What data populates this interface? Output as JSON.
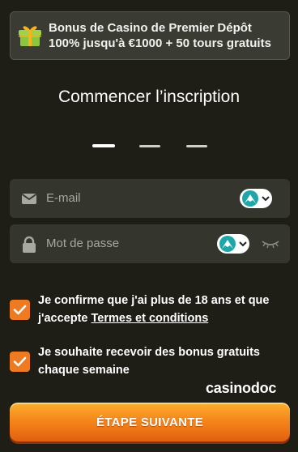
{
  "bonus": {
    "line1": "Bonus de Casino de Premier Dépôt",
    "line2": "100% jusqu'à €1000 + 50 tours gratuits"
  },
  "title": "Commencer l’inscription",
  "steps": {
    "total": 3,
    "current": 1
  },
  "form": {
    "email_placeholder": "E-mail",
    "password_placeholder": "Mot de passe"
  },
  "checkboxes": {
    "age": {
      "text": "Je confirme que j'ai plus de 18 ans et que j'accepte ",
      "link": "Termes et conditions",
      "checked": true
    },
    "bonus_optin": {
      "text": "Je souhaite recevoir des bonus gratuits chaque semaine",
      "checked": true
    }
  },
  "brand": "casinodoc",
  "cta_label": "ÉTAPE SUIVANTE",
  "colors": {
    "background": "#1e1e17",
    "accent": "#ee7a22",
    "field": "#34352d"
  }
}
